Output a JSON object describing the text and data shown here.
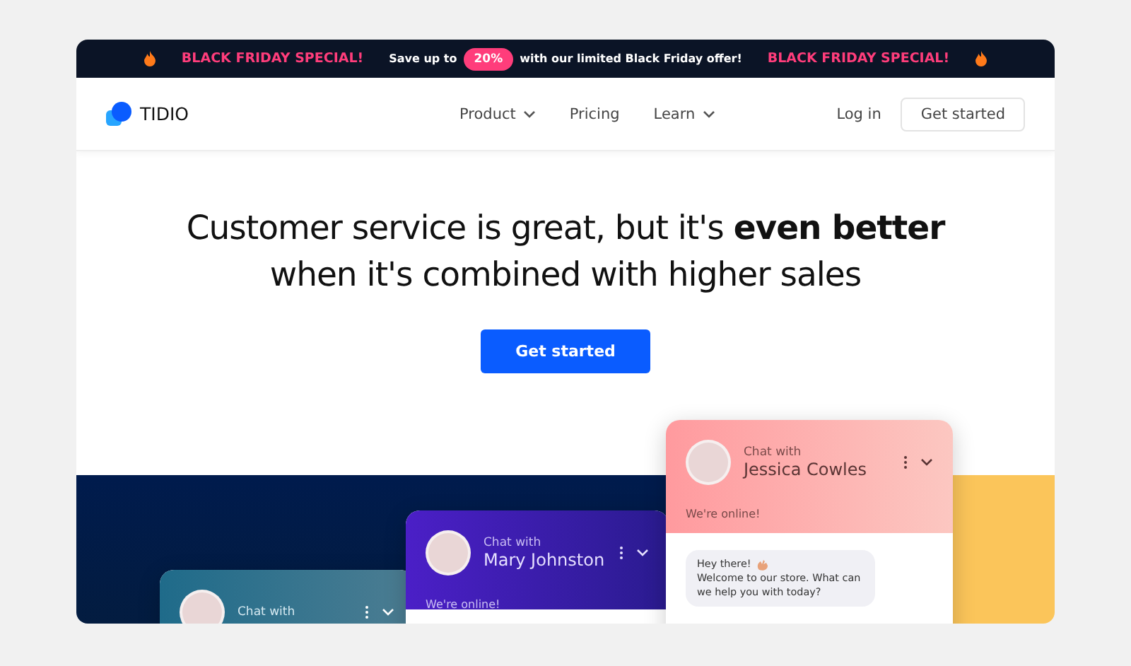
{
  "banner": {
    "left": "BLACK FRIDAY SPECIAL!",
    "before": "Save up to",
    "badge": "20%",
    "after": "with our limited Black Friday offer!",
    "right": "BLACK FRIDAY SPECIAL!"
  },
  "nav": {
    "logo": "TIDIO",
    "links": [
      {
        "label": "Product",
        "dropdown": true
      },
      {
        "label": "Pricing",
        "dropdown": false
      },
      {
        "label": "Learn",
        "dropdown": true
      }
    ],
    "login": "Log in",
    "cta": "Get started"
  },
  "hero": {
    "headline": "Customer service is great, but it's **even better** when it's combined with higher sales",
    "cta": "Get started"
  },
  "chats": [
    {
      "kind": "teal",
      "prefix": "Chat with"
    },
    {
      "kind": "purple",
      "prefix": "Chat with",
      "name": "Mary Johnston",
      "status": "We're online!"
    },
    {
      "kind": "pink",
      "prefix": "Chat with",
      "name": "Jessica Cowles",
      "status": "We're online!",
      "message_start": "Hey there!",
      "message_end": "Welcome to our store. What can we help you with today?"
    }
  ]
}
